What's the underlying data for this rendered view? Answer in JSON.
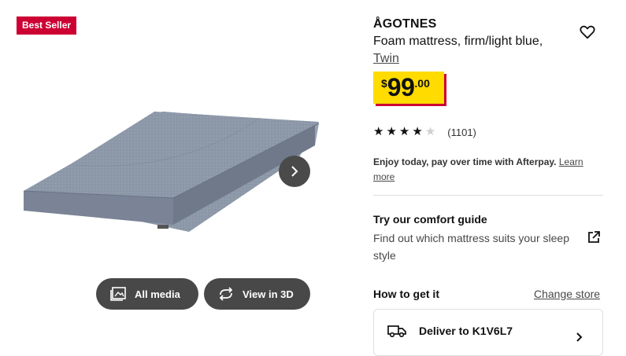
{
  "badge": {
    "label": "Best Seller"
  },
  "product": {
    "name": "ÅGOTNES",
    "description": "Foam mattress, firm/light blue,",
    "size": "Twin"
  },
  "price": {
    "currency": "$",
    "integer": "99",
    "decimal": ".00"
  },
  "rating": {
    "stars": 4,
    "max": 5,
    "count": "(1101)"
  },
  "afterpay": {
    "text": "Enjoy today, pay over time with Afterpay.",
    "link": "Learn more"
  },
  "comfort": {
    "title": "Try our comfort guide",
    "text": "Find out which mattress suits your sleep style"
  },
  "fulfillment": {
    "title": "How to get it",
    "change_store": "Change store",
    "deliver_label": "Deliver to K1V6L7"
  },
  "media": {
    "all_media": "All media",
    "view_3d": "View in 3D"
  },
  "colors": {
    "badge": "#cc0033",
    "price_bg": "#ffdb00",
    "mattress": "#8f9aab",
    "button_bg": "#484848"
  }
}
